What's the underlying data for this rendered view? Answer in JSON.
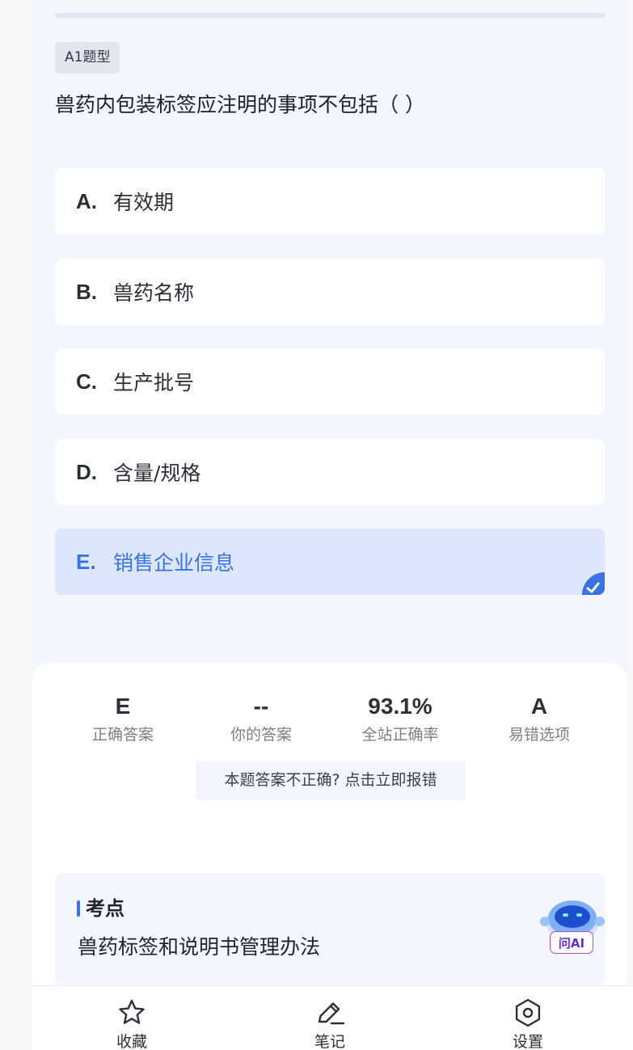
{
  "question": {
    "type_tag": "A1题型",
    "stem": "兽药内包装标签应注明的事项不包括（ ）",
    "options": [
      {
        "letter": "A.",
        "text": "有效期"
      },
      {
        "letter": "B.",
        "text": "兽药名称"
      },
      {
        "letter": "C.",
        "text": "生产批号"
      },
      {
        "letter": "D.",
        "text": "含量/规格"
      },
      {
        "letter": "E.",
        "text": "销售企业信息"
      }
    ]
  },
  "answer": {
    "correct": {
      "value": "E",
      "label": "正确答案"
    },
    "yours": {
      "value": "--",
      "label": "你的答案"
    },
    "rate": {
      "value": "93.1%",
      "label": "全站正确率"
    },
    "common_wrong": {
      "value": "A",
      "label": "易错选项"
    },
    "report_text": "本题答案不正确? 点击立即报错"
  },
  "keypoint": {
    "title": "考点",
    "text": "兽药标签和说明书管理办法",
    "ai_label": "问AI"
  },
  "tabs": [
    {
      "label": "收藏",
      "icon": "star-icon"
    },
    {
      "label": "笔记",
      "icon": "pencil-icon"
    },
    {
      "label": "设置",
      "icon": "gear-icon"
    }
  ],
  "colors": {
    "accent": "#3b72e3",
    "selected_bg": "#dde7fc",
    "panel_bg": "#f3f6fd"
  }
}
